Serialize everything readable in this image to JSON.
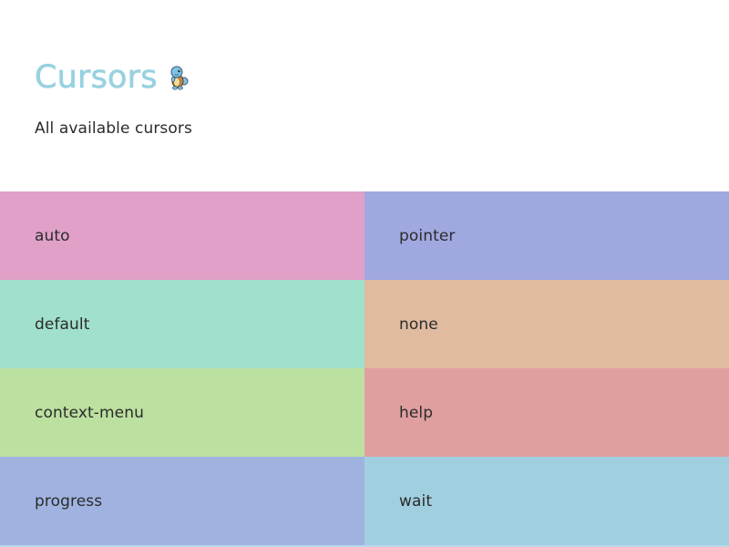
{
  "header": {
    "title": "Cursors",
    "subtitle": "All available cursors",
    "title_color": "#98d1e0",
    "title_icon": "squirtle-icon"
  },
  "cursors": [
    {
      "label": "auto",
      "color": "#e0a0c8"
    },
    {
      "label": "pointer",
      "color": "#a0a8e0"
    },
    {
      "label": "default",
      "color": "#a0e0cc"
    },
    {
      "label": "none",
      "color": "#e0bba0"
    },
    {
      "label": "context-menu",
      "color": "#bce0a0"
    },
    {
      "label": "help",
      "color": "#e09f9f"
    },
    {
      "label": "progress",
      "color": "#a0b3e0"
    },
    {
      "label": "wait",
      "color": "#a0cfe0"
    }
  ]
}
